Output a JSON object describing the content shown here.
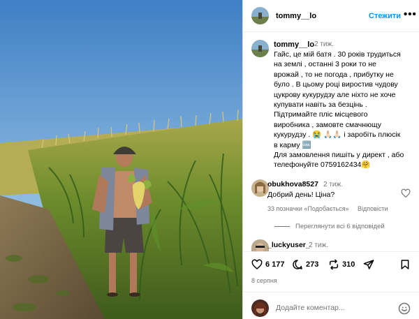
{
  "header": {
    "username": "tommy__lo",
    "follow_label": "Стежити",
    "more_label": "•••",
    "more_icon": "more-horizontal-icon"
  },
  "caption": {
    "username": "tommy__lo",
    "time": "2 тиж.",
    "lines": [
      "Гайс, це мій батя . 30 років трудиться",
      "на землі , останні 3 роки то не",
      "врожай , то не погода , прибутку не",
      "було . В цьому році  виростив чудову",
      "цукрову кукурудзу  але ніхто не хоче",
      "купувати навіть за безцінь .",
      "Підтримайте пліс місцевого",
      "виробника , замовте смачнющу",
      "кукурудзу . 😭 🙏🏻🙏🏻 і заробіть плюсік",
      "в карму 🆒",
      "Для замовлення пишіть у директ , або",
      "телефонуйте 0759162434🤗"
    ]
  },
  "comments": [
    {
      "username": "obukhova8527",
      "time": "2 тиж.",
      "text": "Добрий день! Ціна?",
      "likes": "33 позначки «Подобається»",
      "reply_label": "Відповісти",
      "view_replies": "Переглянути всі 6 відповідей"
    },
    {
      "username": "_luckyuser_",
      "time": "2 тиж."
    }
  ],
  "actions": {
    "likes": "6 177",
    "comments": "273",
    "reposts": "310",
    "icons": [
      "heart-icon",
      "comment-icon",
      "repost-icon",
      "share-icon",
      "bookmark-icon"
    ]
  },
  "date": "8 серпня",
  "comment_box": {
    "placeholder": "Додайте коментар...",
    "emoji_icon": "emoji-icon"
  },
  "colors": {
    "accent": "#0095f6",
    "secondary_text": "#737373",
    "border": "#dbdbdb"
  }
}
